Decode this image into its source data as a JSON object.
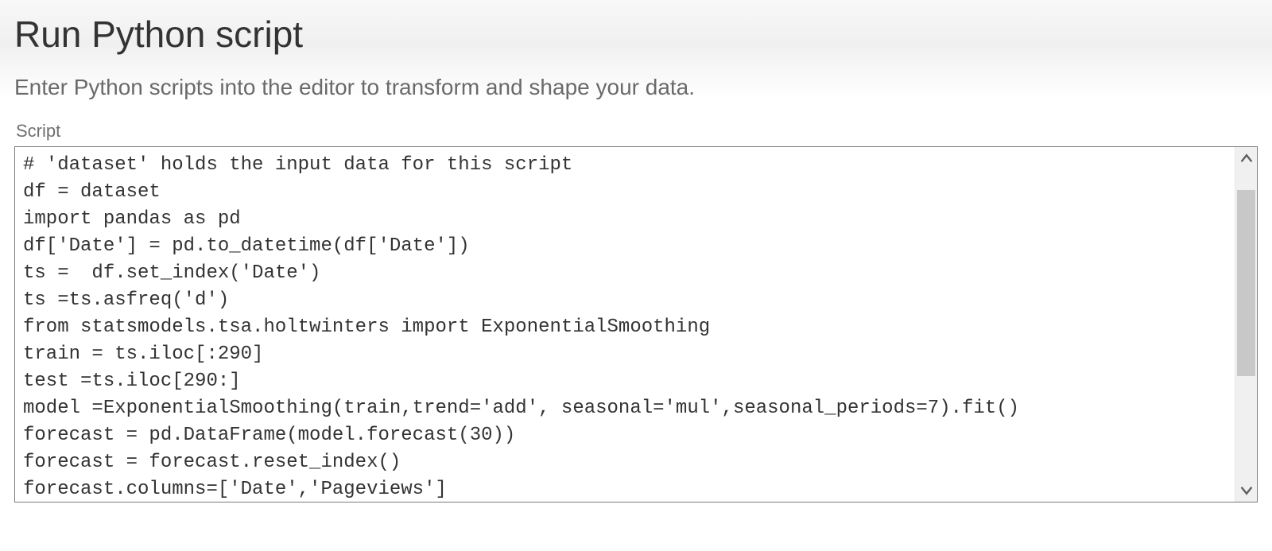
{
  "dialog": {
    "title": "Run Python script",
    "subtitle": "Enter Python scripts into the editor to transform and shape your data.",
    "field_label": "Script",
    "script": "# 'dataset' holds the input data for this script\ndf = dataset\nimport pandas as pd\ndf['Date'] = pd.to_datetime(df['Date'])\nts =  df.set_index('Date')\nts =ts.asfreq('d')\nfrom statsmodels.tsa.holtwinters import ExponentialSmoothing\ntrain = ts.iloc[:290]\ntest =ts.iloc[290:]\nmodel =ExponentialSmoothing(train,trend='add', seasonal='mul',seasonal_periods=7).fit()\nforecast = pd.DataFrame(model.forecast(30))\nforecast = forecast.reset_index()\nforecast.columns=['Date','Pageviews']"
  }
}
